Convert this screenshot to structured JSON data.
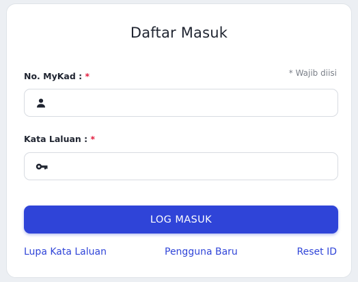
{
  "form": {
    "title": "Daftar Masuk",
    "required_note": "* Wajib diisi",
    "mykad": {
      "label": "No. MyKad :",
      "required_mark": "*",
      "value": "",
      "icon": "person-icon"
    },
    "password": {
      "label": "Kata Laluan :",
      "required_mark": "*",
      "value": "",
      "icon": "key-icon"
    },
    "login_button": "LOG MASUK",
    "links": {
      "forgot_password": "Lupa Kata Laluan",
      "new_user": "Pengguna Baru",
      "reset_id": "Reset ID"
    }
  },
  "colors": {
    "accent": "#2f44d8",
    "required": "#e21b3c",
    "background": "#eceff3",
    "card": "#ffffff"
  }
}
